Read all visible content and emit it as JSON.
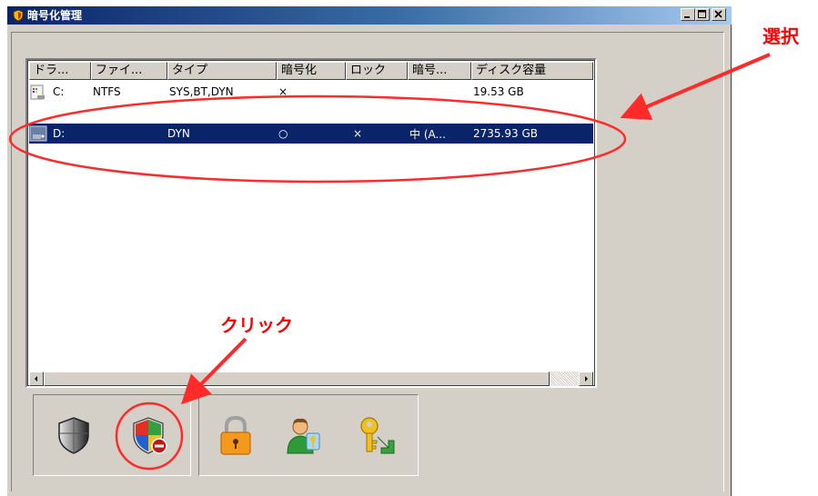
{
  "window": {
    "title": "暗号化管理",
    "minimize_icon": "minimize-icon",
    "maximize_icon": "maximize-icon",
    "close_icon": "close-icon"
  },
  "list": {
    "columns": [
      "ドラ...",
      "ファイ...",
      "タイプ",
      "暗号化",
      "ロック",
      "暗号...",
      "ディスク容量"
    ],
    "rows": [
      {
        "drive": "C:",
        "filesystem": "NTFS",
        "type": "SYS,BT,DYN",
        "encrypted": "×",
        "lock": "",
        "algorithm": "",
        "capacity": "19.53 GB",
        "selected": false
      },
      {
        "drive": "D:",
        "filesystem": "",
        "type": "DYN",
        "encrypted": "○",
        "lock": "×",
        "algorithm": "中 (A...",
        "capacity": "2735.93 GB",
        "selected": true
      }
    ]
  },
  "toolbar": {
    "left_group": [
      "shield-icon",
      "shield-remove-icon"
    ],
    "right_group": [
      "padlock-icon",
      "user-key-icon",
      "key-arrow-icon"
    ]
  },
  "annotations": {
    "select_label": "選択",
    "click_label": "クリック",
    "color": "#ff0000"
  }
}
